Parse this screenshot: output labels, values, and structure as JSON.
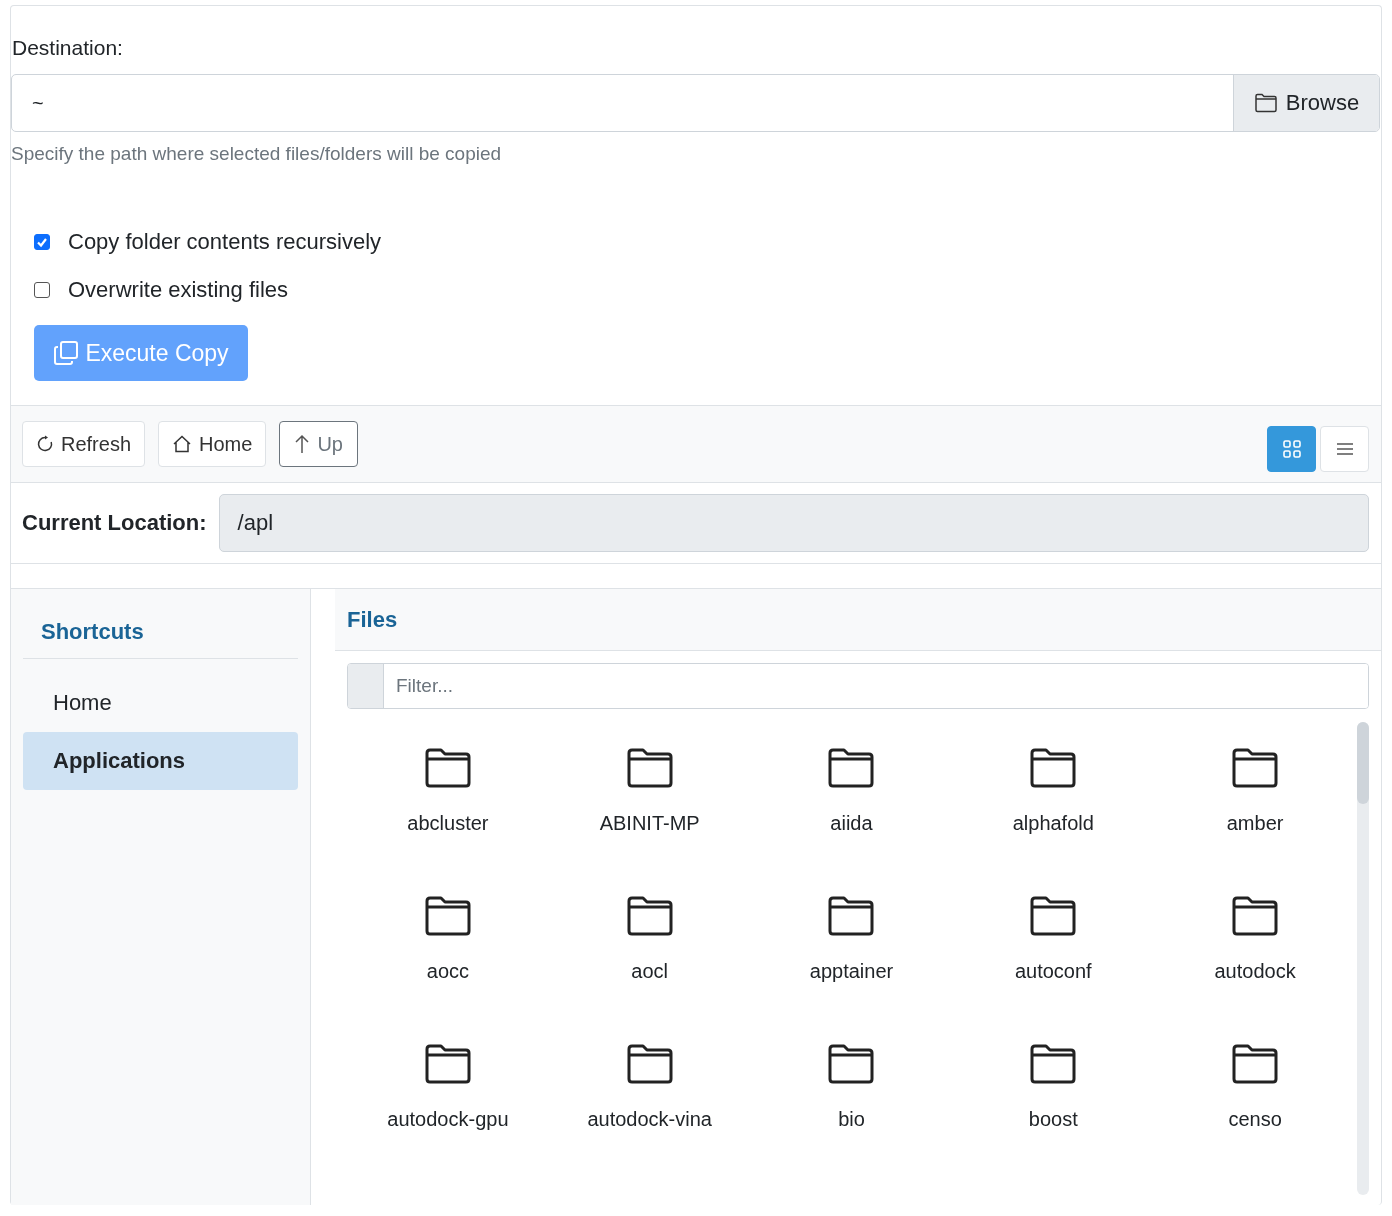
{
  "destination": {
    "label": "Destination:",
    "value": "~",
    "browse": "Browse",
    "help": "Specify the path where selected files/folders will be copied"
  },
  "options": [
    {
      "label": "Copy folder contents recursively",
      "checked": true
    },
    {
      "label": "Overwrite existing files",
      "checked": false
    }
  ],
  "execute_button": "Execute Copy",
  "toolbar": {
    "buttons": [
      {
        "kind": "refresh",
        "label": "Refresh"
      },
      {
        "kind": "home",
        "label": "Home"
      },
      {
        "kind": "up",
        "label": "Up"
      }
    ],
    "views": [
      {
        "kind": "grid",
        "selected": true
      },
      {
        "kind": "list",
        "selected": false
      }
    ]
  },
  "location": {
    "label": "Current Location:",
    "value": "/apl"
  },
  "sidebar": {
    "title": "Shortcuts",
    "items": [
      {
        "label": "Home",
        "selected": false
      },
      {
        "label": "Applications",
        "selected": true
      }
    ]
  },
  "files": {
    "title": "Files",
    "filter_placeholder": "Filter...",
    "items": [
      {
        "name": "abcluster"
      },
      {
        "name": "ABINIT-MP"
      },
      {
        "name": "aiida"
      },
      {
        "name": "alphafold"
      },
      {
        "name": "amber"
      },
      {
        "name": "aocc"
      },
      {
        "name": "aocl"
      },
      {
        "name": "apptainer"
      },
      {
        "name": "autoconf"
      },
      {
        "name": "autodock"
      },
      {
        "name": "autodock-gpu"
      },
      {
        "name": "autodock-vina"
      },
      {
        "name": "bio"
      },
      {
        "name": "boost"
      },
      {
        "name": "censo"
      }
    ]
  }
}
